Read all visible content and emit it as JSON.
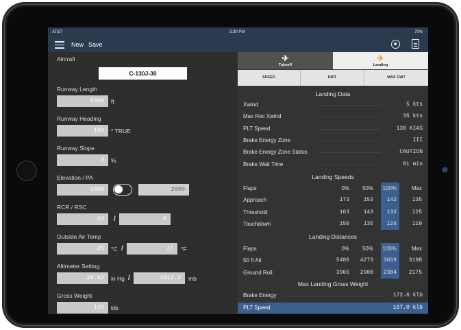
{
  "status": {
    "carrier": "AT&T",
    "time": "3:30 PM",
    "battery": "70%"
  },
  "nav": {
    "new_label": "New",
    "save_label": "Save"
  },
  "aircraft": {
    "label": "Aircraft",
    "value": "C-130J-30"
  },
  "runway_length": {
    "label": "Runway Length",
    "value": "8000",
    "unit": "ft"
  },
  "runway_heading": {
    "label": "Runway Heading",
    "value": "100",
    "unit": "° TRUE"
  },
  "runway_slope": {
    "label": "Runway Slope",
    "value": "0",
    "unit": "%"
  },
  "elevation": {
    "label": "Elevation / PA",
    "value": "2000",
    "pa_value": "2000",
    "toggle_on": false
  },
  "rcr": {
    "label": "RCR / RSC",
    "value": "23",
    "rsc_value": "0",
    "sep": "/"
  },
  "oat": {
    "label": "Outside Air Temp",
    "c_value": "25",
    "c_unit": "°C",
    "sep": "/",
    "f_value": "77",
    "f_unit": "°F"
  },
  "altimeter": {
    "label": "Altimeter Setting",
    "inhg_value": "29.92",
    "inhg_unit": "in Hg",
    "sep": "/",
    "mb_value": "1013.3",
    "mb_unit": "mb"
  },
  "gross_weight": {
    "label": "Gross Weight",
    "value": "135",
    "unit": "klb"
  },
  "tabs": {
    "takeoff": "Takeoff",
    "landing": "Landing"
  },
  "subtabs": {
    "speed": "SPEED",
    "dist": "DIST",
    "max_gwt": "MAX GWT"
  },
  "landing_data": {
    "title": "Landing Data",
    "rows": [
      {
        "label": "Xwind",
        "value": "5 kts"
      },
      {
        "label": "Max Rec Xwind",
        "value": "35 kts"
      },
      {
        "label": "PLT Speed",
        "value": "138 KIAS"
      },
      {
        "label": "Brake Energy Zone",
        "value": "III"
      },
      {
        "label": "Brake Energy Zone Status",
        "value": "CAUTION"
      },
      {
        "label": "Brake Wait Time",
        "value": "81 min"
      }
    ]
  },
  "landing_speeds": {
    "title": "Landing Speeds",
    "header": [
      "Flaps",
      "0%",
      "50%",
      "100%",
      "Max"
    ],
    "rows": [
      [
        "Approach",
        "173",
        "153",
        "142",
        "135"
      ],
      [
        "Threshold",
        "163",
        "143",
        "132",
        "125"
      ],
      [
        "Touchdown",
        "156",
        "135",
        "126",
        "119"
      ]
    ]
  },
  "landing_distances": {
    "title": "Landing Distances",
    "header": [
      "Flaps",
      "0%",
      "50%",
      "100%",
      "Max"
    ],
    "rows": [
      [
        "50 ft Alt",
        "5406",
        "4273",
        "3659",
        "3198"
      ],
      [
        "Ground Roll",
        "3965",
        "2908",
        "2384",
        "2175"
      ]
    ]
  },
  "max_landing_gw": {
    "title": "Max Landing Gross Weight",
    "rows": [
      {
        "label": "Brake Energy",
        "value": "172.6 klb"
      },
      {
        "label": "PLT Speed",
        "value": "167.0 klb"
      }
    ]
  },
  "colors": {
    "nav": "#2b3a4e",
    "highlight": "#3b5f8f",
    "input": "#c9c9c9",
    "panel": "#2e2e2e",
    "landing_icon": "#f0a030"
  }
}
